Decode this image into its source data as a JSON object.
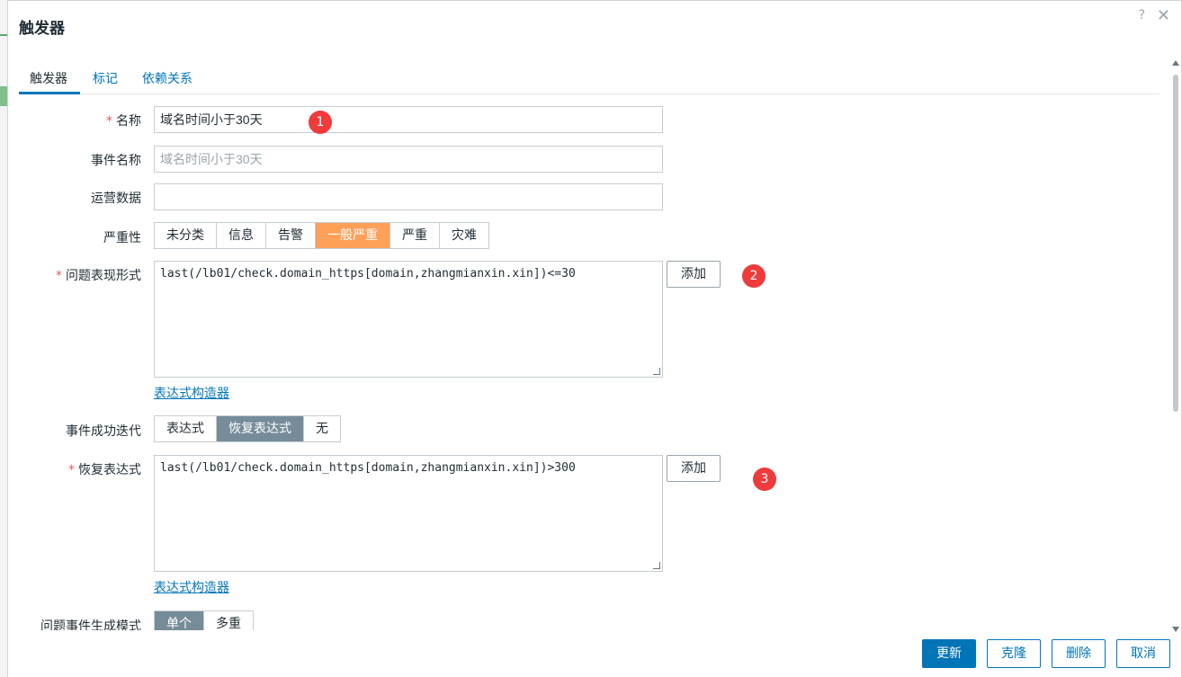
{
  "dialog": {
    "title": "触发器",
    "help": "?",
    "close": "✕"
  },
  "tabs": [
    {
      "label": "触发器",
      "active": true
    },
    {
      "label": "标记",
      "active": false
    },
    {
      "label": "依赖关系",
      "active": false
    }
  ],
  "form": {
    "name": {
      "label": "名称",
      "value": "域名时间小于30天",
      "required": true
    },
    "event_name": {
      "label": "事件名称",
      "placeholder": "域名时间小于30天"
    },
    "opdata": {
      "label": "运营数据",
      "value": ""
    },
    "severity": {
      "label": "严重性",
      "options": [
        "未分类",
        "信息",
        "告警",
        "一般严重",
        "严重",
        "灾难"
      ],
      "selected": "一般严重",
      "selected_color": "#ffa059"
    },
    "problem_expr": {
      "label": "问题表现形式",
      "value": "last(/lb01/check.domain_https[domain,zhangmianxin.xin])<=30",
      "add_label": "添加",
      "builder_link": "表达式构造器"
    },
    "recovery_gen": {
      "label": "事件成功迭代",
      "options": [
        "表达式",
        "恢复表达式",
        "无"
      ],
      "selected": "恢复表达式"
    },
    "recovery_expr": {
      "label": "恢复表达式",
      "value": "last(/lb01/check.domain_https[domain,zhangmianxin.xin])>300",
      "add_label": "添加",
      "builder_link": "表达式构造器"
    },
    "problem_mode": {
      "label": "问题事件生成模式",
      "options": [
        "单个",
        "多重"
      ],
      "selected": "单个"
    }
  },
  "annotations": [
    "1",
    "2",
    "3"
  ],
  "footer": {
    "update": "更新",
    "clone": "克隆",
    "delete": "删除",
    "cancel": "取消"
  },
  "colors": {
    "accent": "#0275b8",
    "badge": "#ef3b3b"
  }
}
